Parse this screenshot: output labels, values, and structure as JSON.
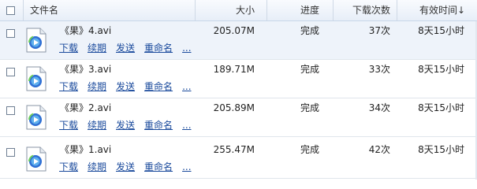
{
  "header": {
    "file_name": "文件名",
    "size": "大小",
    "progress": "进度",
    "download_count": "下载次数",
    "expire_time": "有效时间↓"
  },
  "actions": {
    "download": "下载",
    "renew": "续期",
    "send": "发送",
    "rename": "重命名",
    "more": "..."
  },
  "files": [
    {
      "name": "《果》4.avi",
      "size": "205.07M",
      "progress": "完成",
      "count": "37次",
      "time": "8天15小时"
    },
    {
      "name": "《果》3.avi",
      "size": "189.71M",
      "progress": "完成",
      "count": "33次",
      "time": "8天15小时"
    },
    {
      "name": "《果》2.avi",
      "size": "205.89M",
      "progress": "完成",
      "count": "34次",
      "time": "8天15小时"
    },
    {
      "name": "《果》1.avi",
      "size": "255.47M",
      "progress": "完成",
      "count": "42次",
      "time": "8天15小时"
    }
  ],
  "colors": {
    "link": "#1a4a9c",
    "header_bg": "#e7eef8",
    "selected_row_bg": "#eef3fa"
  },
  "icons": {
    "file_type": "media-player-file-icon"
  }
}
